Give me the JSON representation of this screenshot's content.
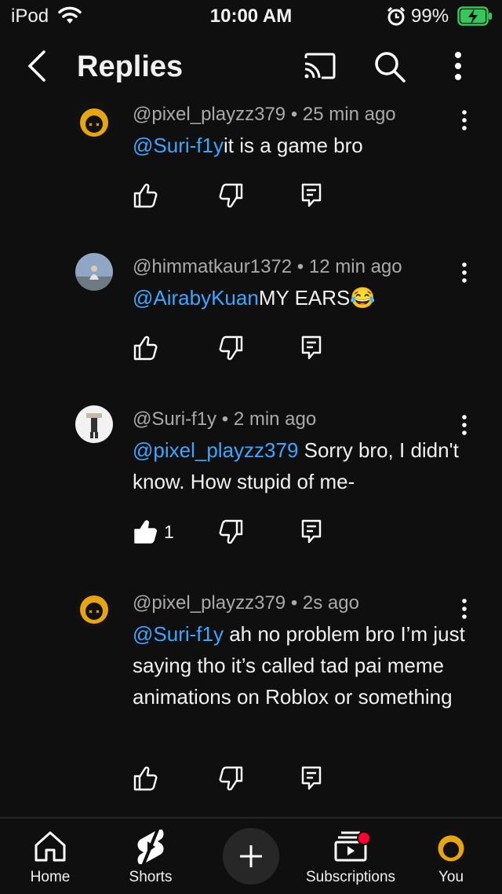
{
  "status_bar": {
    "carrier": "iPod",
    "time": "10:00 AM",
    "battery_percent": "99%",
    "battery_color": "#34c759"
  },
  "header": {
    "title": "Replies",
    "icons": [
      "back-arrow-icon",
      "cast-icon",
      "search-icon",
      "more-vertical-icon"
    ]
  },
  "colors": {
    "background": "#0f0f0f",
    "text": "#f1f1f1",
    "meta": "#aaaaaa",
    "mention": "#3ea6ff"
  },
  "comments": [
    {
      "author": "@pixel_playzz379",
      "time": "25 min ago",
      "mention": "@Suri-f1y",
      "text": "it is a game bro",
      "likes": "",
      "liked": false
    },
    {
      "author": "@himmatkaur1372",
      "time": "12 min ago",
      "mention": "@AirabyKuan",
      "text": "MY EARS😂",
      "likes": "",
      "liked": false
    },
    {
      "author": "@Suri-f1y",
      "time": "2 min ago",
      "mention": "@pixel_playzz379",
      "text": " Sorry bro, I didn't know. How stupid of me-",
      "likes": "1",
      "liked": true
    },
    {
      "author": "@pixel_playzz379",
      "time": "2s ago",
      "mention": "@Suri-f1y",
      "text": " ah no problem bro I’m just saying tho it’s called tad pai meme animations on Roblox or something",
      "likes": "",
      "liked": false
    }
  ],
  "meta_separator": "•",
  "bottom_nav": {
    "home": "Home",
    "shorts": "Shorts",
    "subscriptions": "Subscriptions",
    "you": "You"
  }
}
